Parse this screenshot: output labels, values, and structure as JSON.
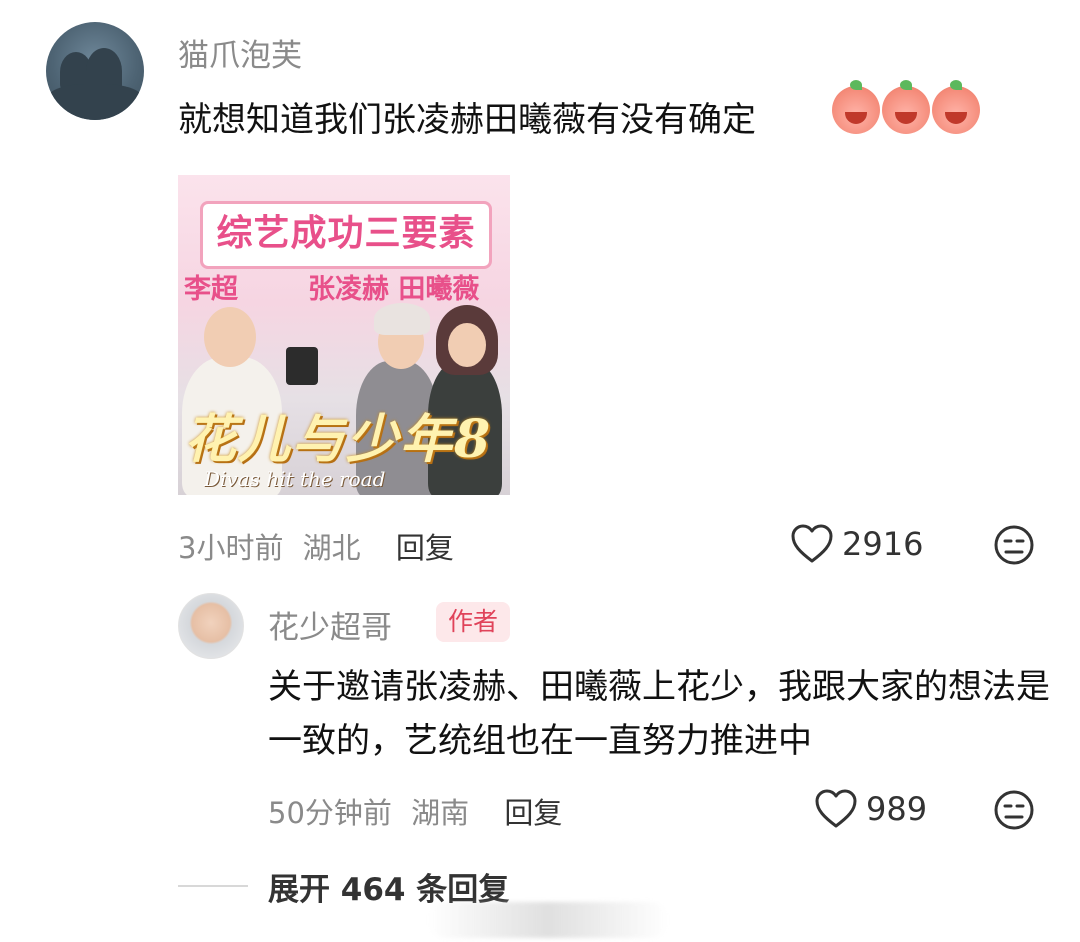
{
  "comment": {
    "username": "猫爪泡芙",
    "text": "就想知道我们张凌赫田曦薇有没有确定",
    "emojis": [
      "peach-emoji",
      "peach-emoji",
      "peach-emoji"
    ],
    "image": {
      "title": "综艺成功三要素",
      "label_left": "李超",
      "label_right": "张凌赫 田曦薇",
      "logo": "花儿与少年8",
      "subtitle": "Divas hit the road"
    },
    "time": "3小时前",
    "location": "湖北",
    "reply_label": "回复",
    "likes": "2916"
  },
  "reply": {
    "username": "花少超哥",
    "badge": "作者",
    "text": "关于邀请张凌赫、田曦薇上花少，我跟大家的想法是一致的，艺统组也在一直努力推进中",
    "time": "50分钟前",
    "location": "湖南",
    "reply_label": "回复",
    "likes": "989"
  },
  "expand": {
    "label": "展开 464 条回复"
  },
  "colors": {
    "badge_bg": "#fde8ea",
    "badge_text": "#e0435a",
    "meta_gray": "#8a8a8a",
    "image_pink": "#e8508a"
  }
}
